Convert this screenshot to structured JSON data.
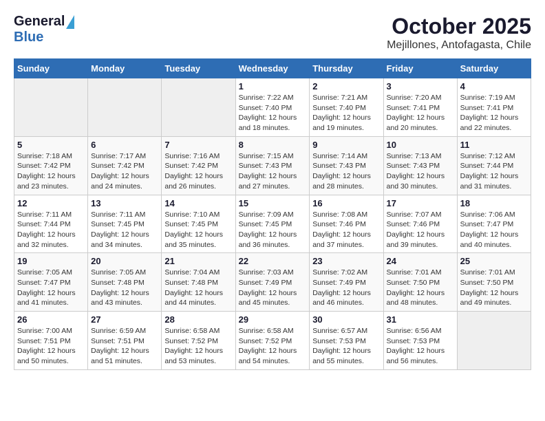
{
  "header": {
    "logo_general": "General",
    "logo_blue": "Blue",
    "title": "October 2025",
    "subtitle": "Mejillones, Antofagasta, Chile"
  },
  "weekdays": [
    "Sunday",
    "Monday",
    "Tuesday",
    "Wednesday",
    "Thursday",
    "Friday",
    "Saturday"
  ],
  "weeks": [
    [
      {
        "day": "",
        "info": ""
      },
      {
        "day": "",
        "info": ""
      },
      {
        "day": "",
        "info": ""
      },
      {
        "day": "1",
        "info": "Sunrise: 7:22 AM\nSunset: 7:40 PM\nDaylight: 12 hours\nand 18 minutes."
      },
      {
        "day": "2",
        "info": "Sunrise: 7:21 AM\nSunset: 7:40 PM\nDaylight: 12 hours\nand 19 minutes."
      },
      {
        "day": "3",
        "info": "Sunrise: 7:20 AM\nSunset: 7:41 PM\nDaylight: 12 hours\nand 20 minutes."
      },
      {
        "day": "4",
        "info": "Sunrise: 7:19 AM\nSunset: 7:41 PM\nDaylight: 12 hours\nand 22 minutes."
      }
    ],
    [
      {
        "day": "5",
        "info": "Sunrise: 7:18 AM\nSunset: 7:42 PM\nDaylight: 12 hours\nand 23 minutes."
      },
      {
        "day": "6",
        "info": "Sunrise: 7:17 AM\nSunset: 7:42 PM\nDaylight: 12 hours\nand 24 minutes."
      },
      {
        "day": "7",
        "info": "Sunrise: 7:16 AM\nSunset: 7:42 PM\nDaylight: 12 hours\nand 26 minutes."
      },
      {
        "day": "8",
        "info": "Sunrise: 7:15 AM\nSunset: 7:43 PM\nDaylight: 12 hours\nand 27 minutes."
      },
      {
        "day": "9",
        "info": "Sunrise: 7:14 AM\nSunset: 7:43 PM\nDaylight: 12 hours\nand 28 minutes."
      },
      {
        "day": "10",
        "info": "Sunrise: 7:13 AM\nSunset: 7:43 PM\nDaylight: 12 hours\nand 30 minutes."
      },
      {
        "day": "11",
        "info": "Sunrise: 7:12 AM\nSunset: 7:44 PM\nDaylight: 12 hours\nand 31 minutes."
      }
    ],
    [
      {
        "day": "12",
        "info": "Sunrise: 7:11 AM\nSunset: 7:44 PM\nDaylight: 12 hours\nand 32 minutes."
      },
      {
        "day": "13",
        "info": "Sunrise: 7:11 AM\nSunset: 7:45 PM\nDaylight: 12 hours\nand 34 minutes."
      },
      {
        "day": "14",
        "info": "Sunrise: 7:10 AM\nSunset: 7:45 PM\nDaylight: 12 hours\nand 35 minutes."
      },
      {
        "day": "15",
        "info": "Sunrise: 7:09 AM\nSunset: 7:45 PM\nDaylight: 12 hours\nand 36 minutes."
      },
      {
        "day": "16",
        "info": "Sunrise: 7:08 AM\nSunset: 7:46 PM\nDaylight: 12 hours\nand 37 minutes."
      },
      {
        "day": "17",
        "info": "Sunrise: 7:07 AM\nSunset: 7:46 PM\nDaylight: 12 hours\nand 39 minutes."
      },
      {
        "day": "18",
        "info": "Sunrise: 7:06 AM\nSunset: 7:47 PM\nDaylight: 12 hours\nand 40 minutes."
      }
    ],
    [
      {
        "day": "19",
        "info": "Sunrise: 7:05 AM\nSunset: 7:47 PM\nDaylight: 12 hours\nand 41 minutes."
      },
      {
        "day": "20",
        "info": "Sunrise: 7:05 AM\nSunset: 7:48 PM\nDaylight: 12 hours\nand 43 minutes."
      },
      {
        "day": "21",
        "info": "Sunrise: 7:04 AM\nSunset: 7:48 PM\nDaylight: 12 hours\nand 44 minutes."
      },
      {
        "day": "22",
        "info": "Sunrise: 7:03 AM\nSunset: 7:49 PM\nDaylight: 12 hours\nand 45 minutes."
      },
      {
        "day": "23",
        "info": "Sunrise: 7:02 AM\nSunset: 7:49 PM\nDaylight: 12 hours\nand 46 minutes."
      },
      {
        "day": "24",
        "info": "Sunrise: 7:01 AM\nSunset: 7:50 PM\nDaylight: 12 hours\nand 48 minutes."
      },
      {
        "day": "25",
        "info": "Sunrise: 7:01 AM\nSunset: 7:50 PM\nDaylight: 12 hours\nand 49 minutes."
      }
    ],
    [
      {
        "day": "26",
        "info": "Sunrise: 7:00 AM\nSunset: 7:51 PM\nDaylight: 12 hours\nand 50 minutes."
      },
      {
        "day": "27",
        "info": "Sunrise: 6:59 AM\nSunset: 7:51 PM\nDaylight: 12 hours\nand 51 minutes."
      },
      {
        "day": "28",
        "info": "Sunrise: 6:58 AM\nSunset: 7:52 PM\nDaylight: 12 hours\nand 53 minutes."
      },
      {
        "day": "29",
        "info": "Sunrise: 6:58 AM\nSunset: 7:52 PM\nDaylight: 12 hours\nand 54 minutes."
      },
      {
        "day": "30",
        "info": "Sunrise: 6:57 AM\nSunset: 7:53 PM\nDaylight: 12 hours\nand 55 minutes."
      },
      {
        "day": "31",
        "info": "Sunrise: 6:56 AM\nSunset: 7:53 PM\nDaylight: 12 hours\nand 56 minutes."
      },
      {
        "day": "",
        "info": ""
      }
    ]
  ]
}
